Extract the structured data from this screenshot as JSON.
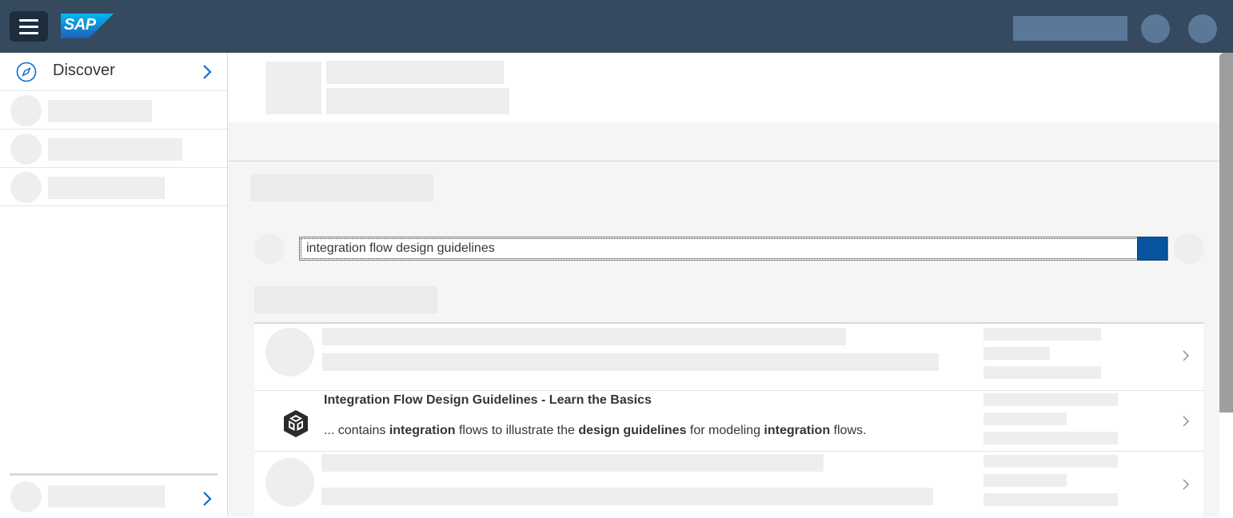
{
  "shell": {
    "logo_text": "SAP",
    "brand_color": "#354a5f",
    "menu_icon": "hamburger-icon"
  },
  "sidebar": {
    "discover_label": "Discover",
    "discover_icon": "compass-icon"
  },
  "search": {
    "value": "integration flow design guidelines",
    "button_color": "#0854a0"
  },
  "results": [
    {
      "title": "Integration Flow Design Guidelines - Learn the Basics",
      "desc_parts": [
        "... contains ",
        "integration",
        " flows to illustrate the ",
        "design guidelines",
        " for modeling ",
        "integration",
        " flows."
      ],
      "icon": "package-icon"
    }
  ]
}
